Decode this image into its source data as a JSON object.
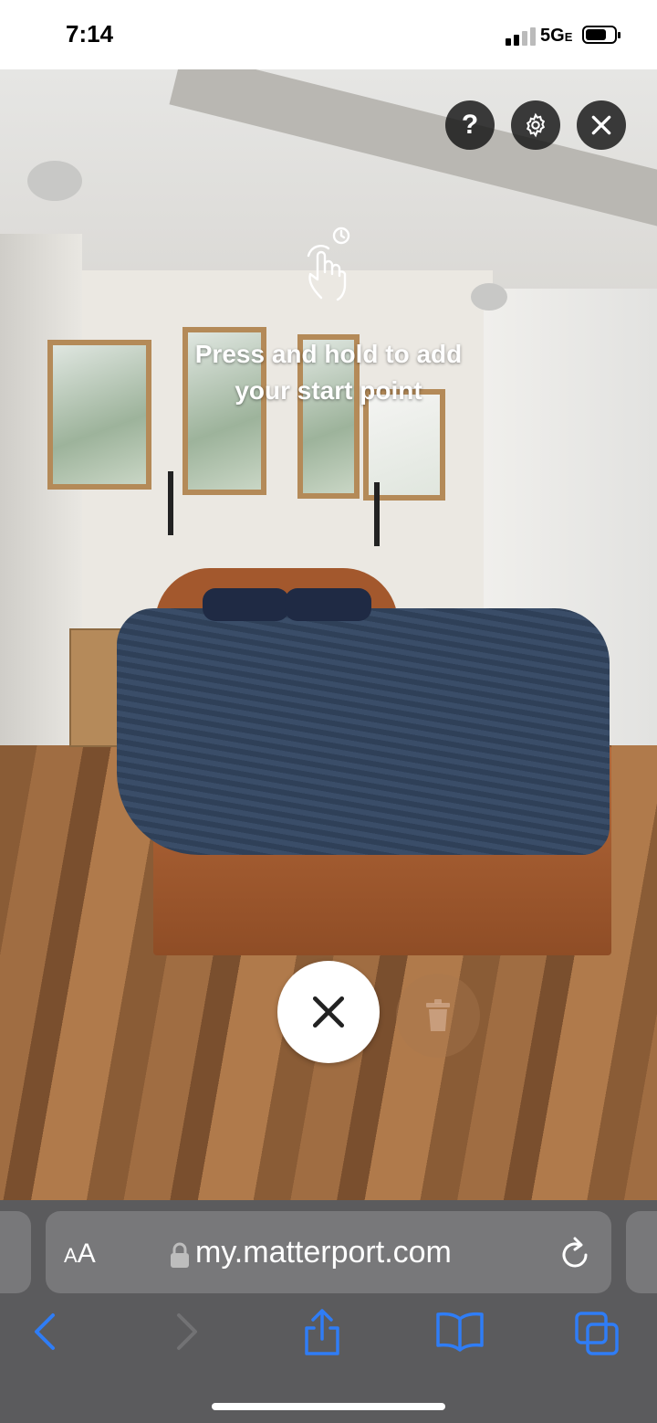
{
  "status_bar": {
    "time": "7:14",
    "network": "5G",
    "network_suffix": "E"
  },
  "overlay": {
    "instruction_line1": "Press and hold to add",
    "instruction_line2": "your start point",
    "help_label": "?"
  },
  "icons": {
    "help": "question-mark-icon",
    "settings": "gear-icon",
    "close": "close-icon",
    "hint": "tap-hold-hand-icon",
    "cancel": "cancel-x-icon",
    "delete": "trash-icon"
  },
  "browser": {
    "text_size_label_small": "A",
    "text_size_label_large": "A",
    "domain": "my.matterport.com"
  },
  "colors": {
    "accent_blue": "#2f7df6",
    "browser_bar": "#5b5b5d",
    "url_field": "#78787a"
  }
}
